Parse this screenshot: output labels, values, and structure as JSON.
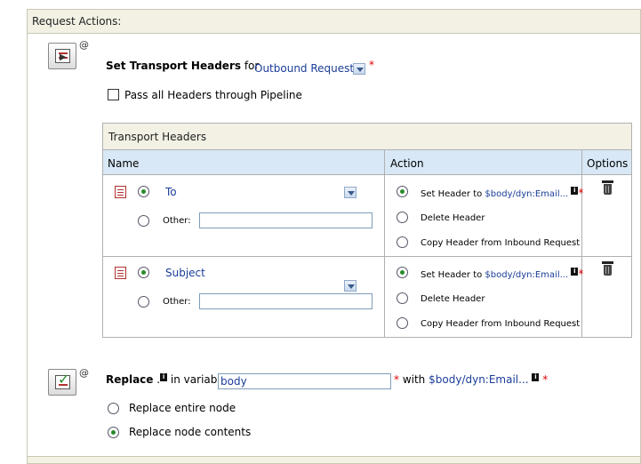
{
  "panel": {
    "title": "Request Actions:"
  },
  "stage1": {
    "at": "@",
    "title": "Set Transport Headers",
    "for_label": "for",
    "direction": "Outbound Request",
    "required": "*",
    "pass_all_label": "Pass all Headers through Pipeline"
  },
  "table": {
    "title": "Transport Headers",
    "columns": {
      "name": "Name",
      "action": "Action",
      "options": "Options"
    },
    "rows": [
      {
        "header_name": "To",
        "other_label": "Other:",
        "other_value": "",
        "set_header_label": "Set Header to",
        "set_header_expr": "$body/dyn:Email...",
        "required": "*",
        "delete_label": "Delete Header",
        "copy_label": "Copy Header from Inbound Request"
      },
      {
        "header_name": "Subject",
        "other_label": "Other:",
        "other_value": "",
        "set_header_label": "Set Header to",
        "set_header_expr": "$body/dyn:Email...",
        "required": "*",
        "delete_label": "Delete Header",
        "copy_label": "Copy Header from Inbound Request"
      }
    ]
  },
  "stage2": {
    "at": "@",
    "title": "Replace",
    "period": ".",
    "in_variable_label": "in variable",
    "variable_value": "body",
    "required": "*",
    "with_label": "with",
    "with_expr": "$body/dyn:Email...",
    "replace_entire_label": "Replace entire node",
    "replace_contents_label": "Replace node contents"
  },
  "icons": {
    "info": "i"
  },
  "colors": {
    "link": "#1a3d99",
    "required": "#e00000",
    "radio_selected": "#2a8a2a",
    "column_header_bg": "#d8e8f6"
  }
}
